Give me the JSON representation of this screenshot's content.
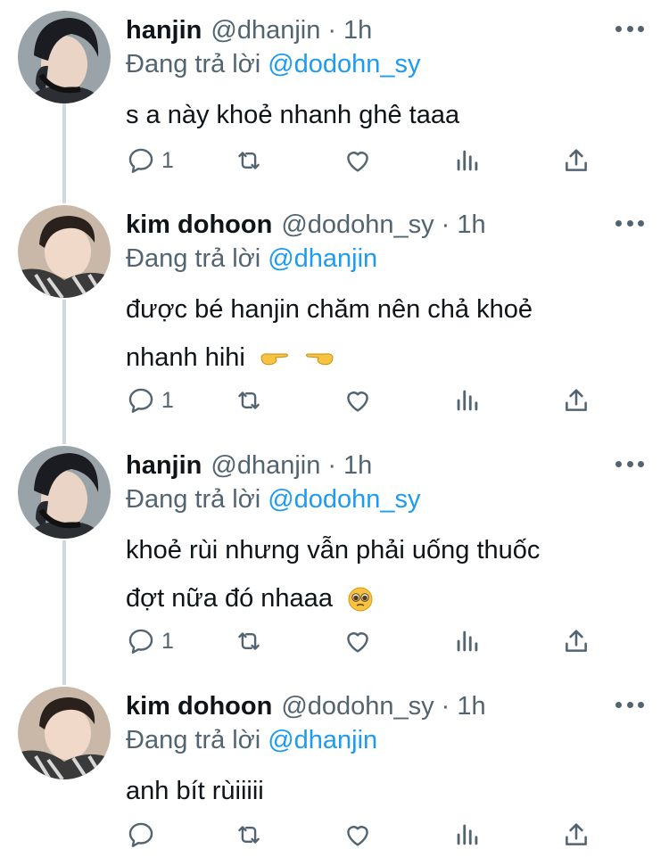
{
  "thread": [
    {
      "name": "hanjin",
      "handle": "@dhanjin",
      "separator": "·",
      "time": "1h",
      "reply_prefix": "Đang trả lời",
      "reply_to": "@dodohn_sy",
      "lines": [
        "s a này khoẻ nhanh ghê taaa"
      ],
      "emoji": [],
      "reply_count": "1",
      "avatar_style": "dark-hair-headphones"
    },
    {
      "name": "kim dohoon",
      "handle": "@dodohn_sy",
      "separator": "·",
      "time": "1h",
      "reply_prefix": "Đang trả lời",
      "reply_to": "@dhanjin",
      "lines": [
        "được bé hanjin chăm nên chả khoẻ",
        "nhanh hihi"
      ],
      "emoji": [
        "backhand-index-pointing-right",
        "backhand-index-pointing-left"
      ],
      "reply_count": "1",
      "avatar_style": "striped-shirt"
    },
    {
      "name": "hanjin",
      "handle": "@dhanjin",
      "separator": "·",
      "time": "1h",
      "reply_prefix": "Đang trả lời",
      "reply_to": "@dodohn_sy",
      "lines": [
        "khoẻ rùi nhưng vẫn phải uống thuốc",
        "đợt nữa đó nhaaa"
      ],
      "emoji": [
        "pleading-face"
      ],
      "reply_count": "1",
      "avatar_style": "dark-hair-headphones"
    },
    {
      "name": "kim dohoon",
      "handle": "@dodohn_sy",
      "separator": "·",
      "time": "1h",
      "reply_prefix": "Đang trả lời",
      "reply_to": "@dhanjin",
      "lines": [
        "anh bít rùiiiii"
      ],
      "emoji": [],
      "reply_count": "",
      "avatar_style": "striped-shirt"
    }
  ],
  "icons": {
    "reply": "reply-icon",
    "retweet": "retweet-icon",
    "like": "like-icon",
    "analytics": "analytics-icon",
    "share": "share-icon",
    "more": "more-options-icon"
  },
  "colors": {
    "text": "#0f1419",
    "secondary": "#536471",
    "link": "#1d9bf0",
    "thread_line": "#cfd9de"
  }
}
